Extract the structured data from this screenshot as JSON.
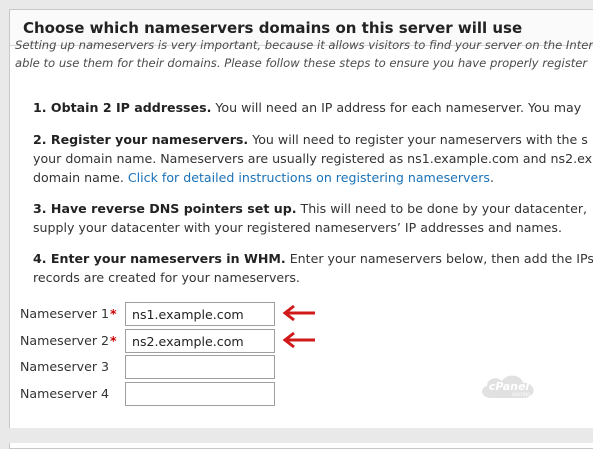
{
  "panel": {
    "title": "Choose which nameservers domains on this server will use",
    "intro_line1": "Setting up nameservers is very important, because it allows visitors to find your server on the Inter",
    "intro_line2": "able to use them for their domains. Please follow these steps to ensure you have properly register"
  },
  "steps": {
    "s1_bold": "1. Obtain 2 IP addresses.",
    "s1_text": " You will need an IP address for each nameserver. You may",
    "s2_bold": "2. Register your nameservers.",
    "s2_text1": " You will need to register your nameservers with the s",
    "s2_line2": "your domain name. Nameservers are usually registered as ns1.example.com and ns2.ex",
    "s2_line3": "domain name. ",
    "s2_link": "Click for detailed instructions on registering nameservers",
    "s2_after": ".",
    "s3_bold": "3. Have reverse DNS pointers set up.",
    "s3_text1": " This will need to be done by your datacenter,",
    "s3_line2": "supply your datacenter with your registered nameservers’ IP addresses and names.",
    "s4_bold": "4. Enter your nameservers in WHM.",
    "s4_text1": " Enter your nameservers below, then add the IPs",
    "s4_line2": "records are created for your nameservers."
  },
  "nameservers": [
    {
      "label": "Nameserver 1",
      "required": "*",
      "value": "ns1.example.com"
    },
    {
      "label": "Nameserver 2",
      "required": "*",
      "value": "ns2.example.com"
    },
    {
      "label": "Nameserver 3",
      "value": ""
    },
    {
      "label": "Nameserver 4",
      "value": ""
    }
  ],
  "logo": {
    "text": "cPanel",
    "subtext": "HOSTING"
  },
  "colors": {
    "link": "#1a72b8",
    "required": "#cc0000",
    "arrow": "#d11a1a"
  }
}
